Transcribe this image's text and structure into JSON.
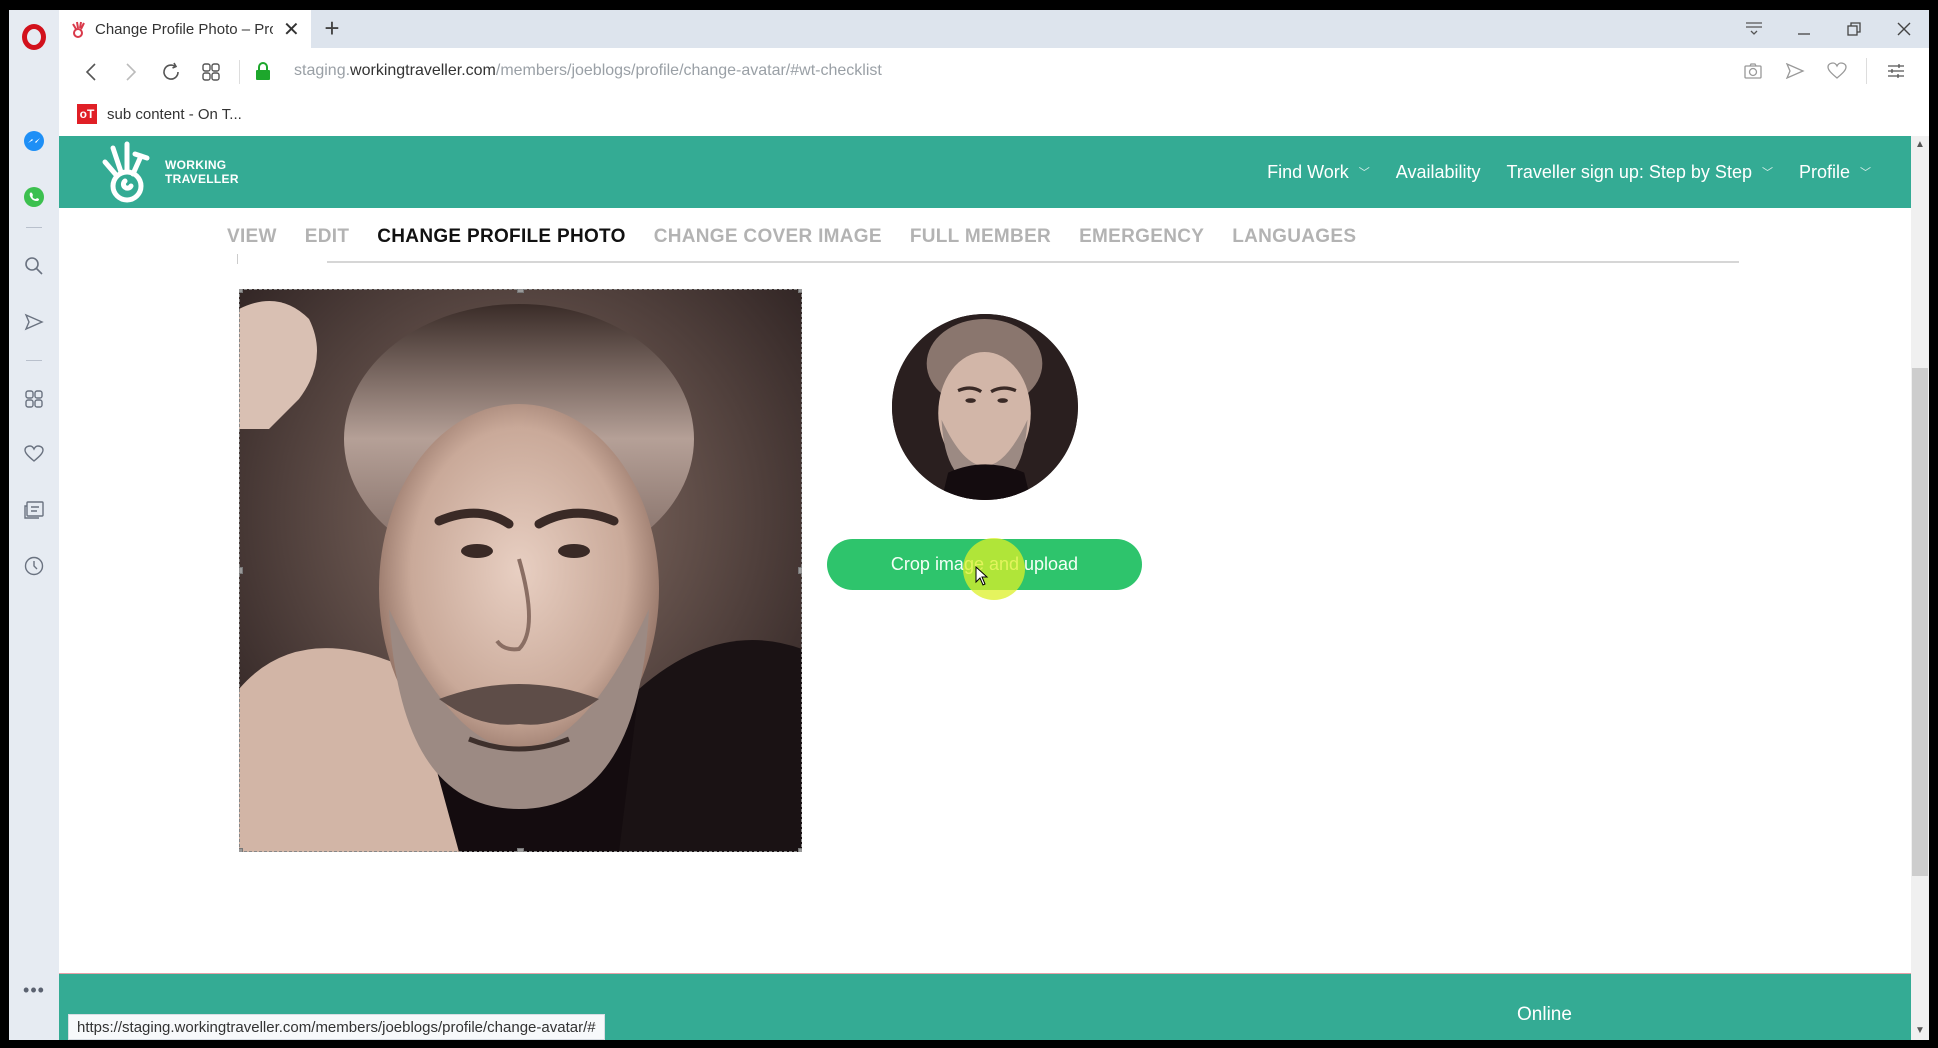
{
  "browser": {
    "tab": {
      "title": "Change Profile Photo – Pro",
      "favicon": "working-traveller-hand-icon"
    },
    "new_tab_label": "+",
    "address": {
      "scheme_prefix": "staging.",
      "host": "workingtraveller.com",
      "path": "/members/joeblogs/profile/change-avatar/#wt-checklist",
      "secure": true
    },
    "bookmarks": [
      {
        "label": "sub content - On T...",
        "favicon_text": "oT"
      }
    ],
    "status_url": "https://staging.workingtraveller.com/members/joeblogs/profile/change-avatar/#",
    "sidebar_icons": [
      "messenger-icon",
      "whatsapp-icon",
      "search-icon",
      "send-icon",
      "speed-dial-icon",
      "heart-icon",
      "news-icon",
      "history-icon"
    ],
    "more_label": "•••"
  },
  "site": {
    "logo": {
      "line1": "WORKING",
      "line2": "TRAVELLER"
    },
    "nav": [
      {
        "label": "Find Work",
        "has_dropdown": true
      },
      {
        "label": "Availability",
        "has_dropdown": false
      },
      {
        "label": "Traveller sign up: Step by Step",
        "has_dropdown": true
      },
      {
        "label": "Profile",
        "has_dropdown": true
      }
    ],
    "profile_tabs": [
      {
        "label": "VIEW",
        "active": false
      },
      {
        "label": "EDIT",
        "active": false
      },
      {
        "label": "CHANGE PROFILE PHOTO",
        "active": true
      },
      {
        "label": "CHANGE COVER IMAGE",
        "active": false
      },
      {
        "label": "FULL MEMBER",
        "active": false
      },
      {
        "label": "EMERGENCY",
        "active": false
      },
      {
        "label": "LANGUAGES",
        "active": false
      }
    ],
    "crop_button_label": "Crop image and upload",
    "footer": {
      "online_label": "Online"
    }
  },
  "colors": {
    "brand_teal": "#34ab94",
    "button_green": "#2ec46c",
    "opera_red": "#d2111c"
  }
}
